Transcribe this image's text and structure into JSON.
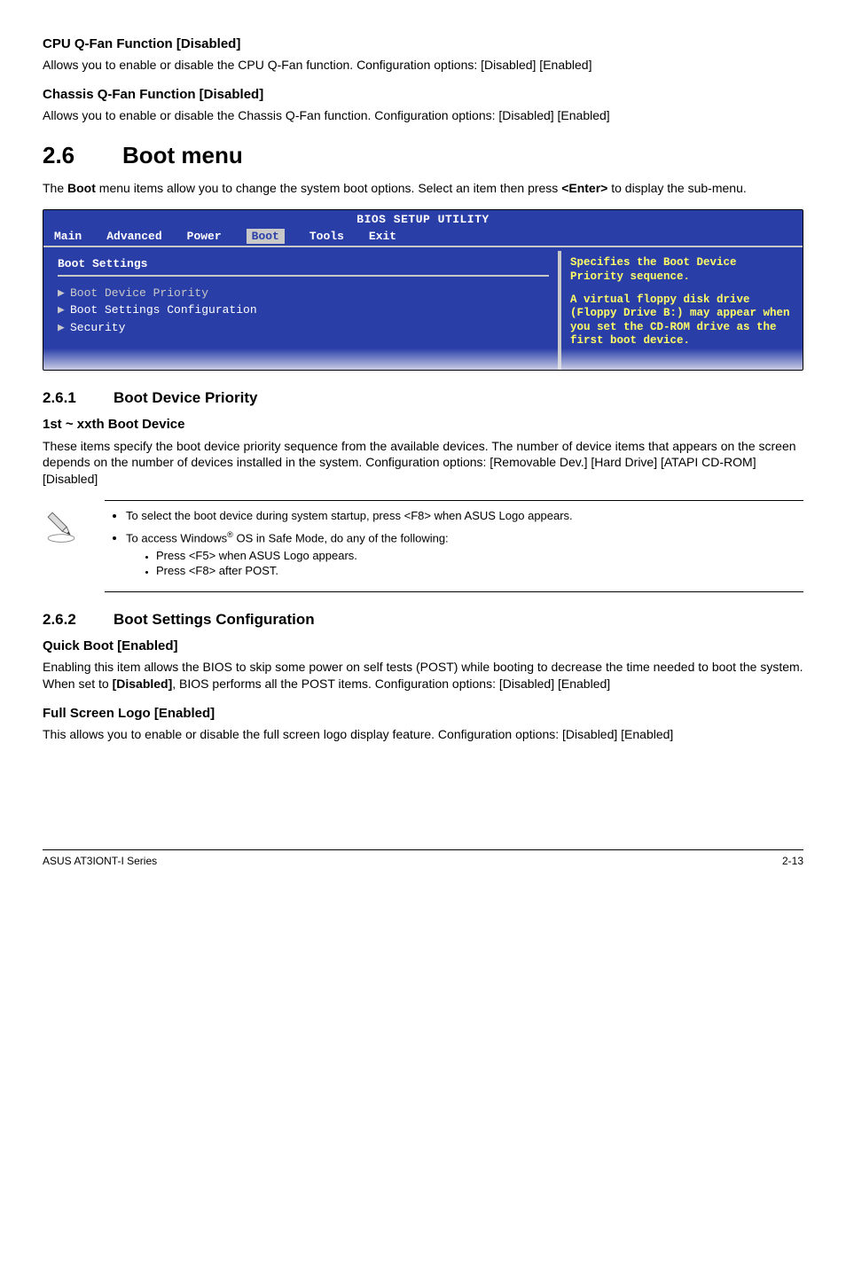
{
  "section_cpu_qfan": {
    "heading": "CPU Q-Fan Function [Disabled]",
    "body": "Allows you to enable or disable the CPU Q-Fan function. Configuration options: [Disabled] [Enabled]"
  },
  "section_chassis_qfan": {
    "heading": "Chassis Q-Fan Function [Disabled]",
    "body": "Allows you to enable or disable the Chassis Q-Fan function. Configuration options: [Disabled] [Enabled]"
  },
  "section_boot_menu": {
    "number": "2.6",
    "title": "Boot menu",
    "intro_pre": "The ",
    "intro_bold1": "Boot",
    "intro_mid": " menu items allow you to change the system boot options. Select an item then press ",
    "intro_bold2": "<Enter>",
    "intro_post": " to display the sub-menu."
  },
  "bios": {
    "title": "BIOS SETUP UTILITY",
    "menu": {
      "main": "Main",
      "advanced": "Advanced",
      "power": "Power",
      "boot": "Boot",
      "tools": "Tools",
      "exit": "Exit"
    },
    "left": {
      "heading": "Boot Settings",
      "items": [
        "Boot Device Priority",
        "Boot Settings Configuration",
        "Security"
      ]
    },
    "right": {
      "line1": "Specifies the Boot Device Priority sequence.",
      "line2": "A virtual floppy disk drive (Floppy Drive B:) may appear when you set the CD-ROM drive as the first boot device."
    }
  },
  "section_261": {
    "number": "2.6.1",
    "title": "Boot Device Priority",
    "sub_heading": "1st ~ xxth Boot Device",
    "body": "These items specify the boot device priority sequence from the available devices. The number of device items that appears on the screen depends on the number of devices installed in the system. Configuration options: [Removable Dev.] [Hard Drive] [ATAPI CD-ROM] [Disabled]"
  },
  "note": {
    "bullet1": "To select the boot device during system startup, press <F8> when ASUS Logo appears.",
    "bullet2_pre": "To access Windows",
    "bullet2_post": " OS in Safe Mode, do any of the following:",
    "sub1": "Press <F5> when ASUS Logo appears.",
    "sub2": "Press <F8> after POST."
  },
  "section_262": {
    "number": "2.6.2",
    "title": "Boot Settings Configuration",
    "quick_boot": {
      "heading": "Quick Boot [Enabled]",
      "body_pre": "Enabling this item allows the BIOS to skip some power on self tests (POST) while booting to decrease the time needed to boot the system. When set to ",
      "body_bold": "[Disabled]",
      "body_post": ", BIOS performs all the POST items. Configuration options: [Disabled] [Enabled]"
    },
    "full_logo": {
      "heading": "Full Screen Logo [Enabled]",
      "body": "This allows you to enable or disable the full screen logo display feature. Configuration options: [Disabled] [Enabled]"
    }
  },
  "footer": {
    "left": "ASUS AT3IONT-I Series",
    "right": "2-13"
  }
}
